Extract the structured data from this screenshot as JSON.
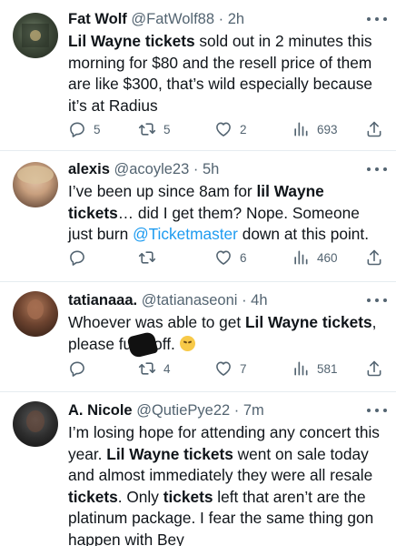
{
  "tweets": [
    {
      "name": "Fat Wolf",
      "handle": "@FatWolf88",
      "time": "2h",
      "text": [
        {
          "t": "Lil Wayne tickets",
          "b": true
        },
        {
          "t": " sold out in 2 minutes this morning for $80 and the resell price of them are like $300, that’s wild especially because it’s at Radius"
        }
      ],
      "replies": "5",
      "retweets": "5",
      "likes": "2",
      "views": "693"
    },
    {
      "name": "alexis",
      "handle": "@acoyle23",
      "time": "5h",
      "text": [
        {
          "t": "I’ve been up since 8am for "
        },
        {
          "t": "lil Wayne tickets",
          "b": true
        },
        {
          "t": "… did I get them? Nope. Someone just burn "
        },
        {
          "t": "@Ticketmaster",
          "m": true
        },
        {
          "t": " down at this point."
        }
      ],
      "replies": "",
      "retweets": "",
      "likes": "6",
      "views": "460"
    },
    {
      "name": "tatianaaa.",
      "handle": "@tatianaseoni",
      "time": "4h",
      "text": [
        {
          "t": "Whoever was able to get "
        },
        {
          "t": "Lil Wayne tickets",
          "b": true
        },
        {
          "t": ", please fu     off. "
        },
        {
          "emoji": "pensive-face"
        }
      ],
      "replies": "",
      "retweets": "4",
      "likes": "7",
      "views": "581"
    },
    {
      "name": "A. Nicole",
      "handle": "@QutiePye22",
      "time": "7m",
      "text": [
        {
          "t": "I’m losing hope for attending any concert this year. "
        },
        {
          "t": "Lil Wayne tickets",
          "b": true
        },
        {
          "t": " went on sale today and almost immediately they were all resale "
        },
        {
          "t": "tickets",
          "b": true
        },
        {
          "t": ". Only "
        },
        {
          "t": "tickets",
          "b": true
        },
        {
          "t": " left that aren’t are the platinum package. I fear the same thing gon happen with Bey"
        }
      ]
    }
  ],
  "colors": {
    "link": "#1d9bf0",
    "muted": "#536471",
    "text": "#0f1419",
    "divider": "#e6ecf0"
  },
  "icons": [
    "reply-icon",
    "retweet-icon",
    "like-icon",
    "views-icon",
    "share-icon",
    "more-icon"
  ]
}
